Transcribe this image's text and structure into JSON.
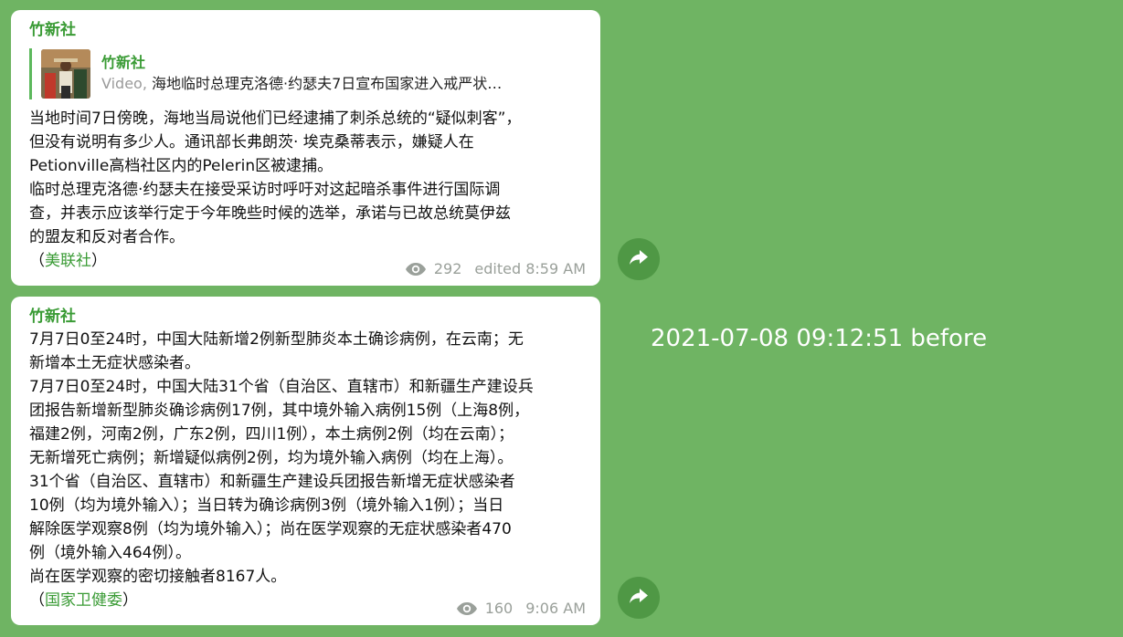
{
  "messages": [
    {
      "channel": "竹新社",
      "reply": {
        "name": "竹新社",
        "type_label": "Video,",
        "preview": " 海地临时总理克洛德·约瑟夫7日宣布国家进入戒严状…"
      },
      "lines": [
        "当地时间7日傍晚，海地当局说他们已经逮捕了刺杀总统的“疑似刺客”，",
        "但没有说明有多少人。通讯部长弗朗茨· 埃克桑蒂表示，嫌疑人在",
        "Petionville高档社区内的Pelerin区被逮捕。",
        "临时总理克洛德·约瑟夫在接受采访时呼吁对这起暗杀事件进行国际调",
        "查，并表示应该举行定于今年晚些时候的选举，承诺与已故总统莫伊兹",
        "的盟友和反对者合作。"
      ],
      "source_open": "（",
      "source": "美联社",
      "source_close": "）",
      "views": "292",
      "time": "edited 8:59 AM"
    },
    {
      "channel": "竹新社",
      "lines": [
        "7月7日0至24时，中国大陆新增2例新型肺炎本土确诊病例，在云南；无",
        "新增本土无症状感染者。",
        "7月7日0至24时，中国大陆31个省（自治区、直辖市）和新疆生产建设兵",
        "团报告新增新型肺炎确诊病例17例，其中境外输入病例15例（上海8例，",
        "福建2例，河南2例，广东2例，四川1例），本土病例2例（均在云南）；",
        "无新增死亡病例；新增疑似病例2例，均为境外输入病例（均在上海）。",
        "31个省（自治区、直辖市）和新疆生产建设兵团报告新增无症状感染者",
        "10例（均为境外输入）；当日转为确诊病例3例（境外输入1例）；当日",
        "解除医学观察8例（均为境外输入）；尚在医学观察的无症状感染者470",
        "例（境外输入464例）。",
        "尚在医学观察的密切接触者8167人。"
      ],
      "source_open": "（",
      "source": "国家卫健委",
      "source_close": "）",
      "views": "160",
      "time": "9:06 AM"
    }
  ],
  "overlay_timestamp": "2021-07-08 09:12:51 before",
  "icons": {
    "views": "eye-icon",
    "share": "share-arrow-icon"
  },
  "colors": {
    "background": "#6fb463",
    "accent": "#3a9b35",
    "share_button": "#4f9845"
  }
}
